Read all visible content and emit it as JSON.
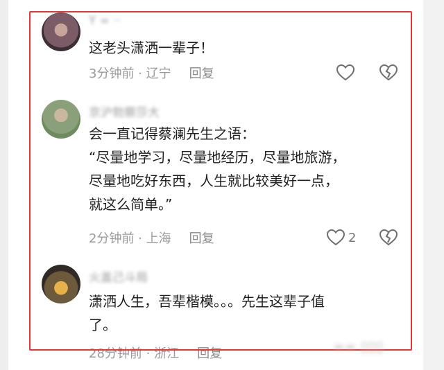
{
  "comments": [
    {
      "username": "Y ∞ ··",
      "text_lines": [
        "这老头潇洒一辈子！"
      ],
      "time": "3分钟前",
      "location": "辽宁",
      "reply_label": "回复",
      "likes": ""
    },
    {
      "username": "京沪勃察莎大",
      "text_lines": [
        "会一直记得蔡澜先生之语：",
        "“尽量地学习，尽量地经历，尽量地旅游，",
        "尽量地吃好东西，人生就比较美好一点，",
        "就这么简单。”"
      ],
      "time": "2分钟前",
      "location": "上海",
      "reply_label": "回复",
      "likes": "2"
    },
    {
      "username": "火盖己斗局",
      "text_lines": [
        "潇洒人生，吾辈楷模。。。先生这辈子值",
        "了。"
      ],
      "time": "28分钟前",
      "location": "浙江",
      "reply_label": "回复",
      "likes": ""
    }
  ],
  "watermark": "∞∞ ▯▯▯",
  "colors": {
    "highlight": "#e8323c",
    "text": "#1f1f1f",
    "meta": "#9a9a9a"
  },
  "icons": [
    "avatar",
    "heart-outline-icon",
    "broken-heart-icon"
  ]
}
